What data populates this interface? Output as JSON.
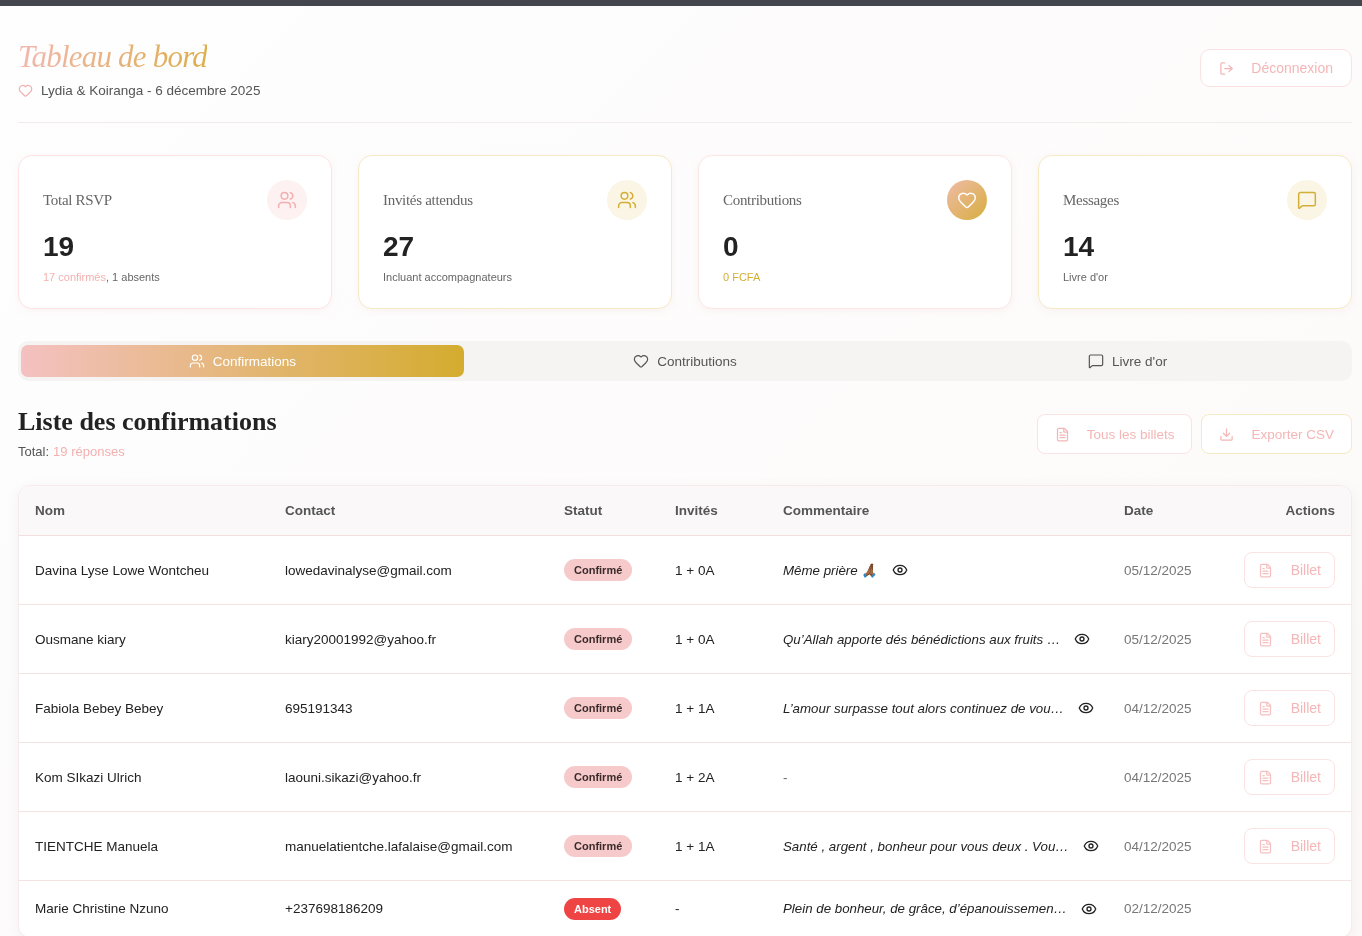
{
  "header": {
    "title": "Tableau de bord",
    "subtitle": "Lydia & Koiranga - 6 décembre 2025",
    "logout_button": "Déconnexion"
  },
  "stats": [
    {
      "label": "Total RSVP",
      "value": "19",
      "kind": "pink",
      "details": [
        {
          "text": "17 confirmés",
          "highlight": true
        },
        {
          "text": ", 1 absents",
          "highlight": false
        }
      ]
    },
    {
      "label": "Invités attendus",
      "value": "27",
      "kind": "gold",
      "details": [
        {
          "text": "Incluant accompagnateurs",
          "highlight": false
        }
      ]
    },
    {
      "label": "Contributions",
      "value": "0",
      "kind": "gradient",
      "details": [
        {
          "text": "0 FCFA",
          "highlight": true
        }
      ]
    },
    {
      "label": "Messages",
      "value": "14",
      "kind": "gold",
      "details": [
        {
          "text": "Livre d'or",
          "highlight": false
        }
      ]
    }
  ],
  "tabs": [
    {
      "label": "Confirmations",
      "selected": true
    },
    {
      "label": "Contributions",
      "selected": false
    },
    {
      "label": "Livre d'or",
      "selected": false
    }
  ],
  "section": {
    "title": "Liste des confirmations",
    "total_label": "Total:",
    "total_value": "19 réponses",
    "buttons": [
      "Tous les billets",
      "Exporter CSV"
    ]
  },
  "table": {
    "columns": [
      "Nom",
      "Contact",
      "Statut",
      "Invités",
      "Commentaire",
      "Date",
      "Actions"
    ],
    "rows": [
      {
        "name": "Davina Lyse Lowe Wontcheu",
        "contact": "lowedavinalyse@gmail.com",
        "status": {
          "label": "Confirmé",
          "kind": "confirmed"
        },
        "guests": "1 + 0A",
        "comment": "Même prière 🙏🏾",
        "viewable": true,
        "date": "05/12/2025",
        "action": "Billet"
      },
      {
        "name": "Ousmane kiary",
        "contact": "kiary20001992@yahoo.fr",
        "status": {
          "label": "Confirmé",
          "kind": "confirmed"
        },
        "guests": "1 + 0A",
        "comment": "Qu’Allah apporte dés bénédictions aux fruits …",
        "viewable": true,
        "date": "05/12/2025",
        "action": "Billet"
      },
      {
        "name": "Fabiola Bebey Bebey",
        "contact": "695191343",
        "status": {
          "label": "Confirmé",
          "kind": "confirmed"
        },
        "guests": "1 + 1A",
        "comment": "L’amour surpasse tout alors continuez de vou…",
        "viewable": true,
        "date": "04/12/2025",
        "action": "Billet"
      },
      {
        "name": "Kom SIkazi Ulrich",
        "contact": "laouni.sikazi@yahoo.fr",
        "status": {
          "label": "Confirmé",
          "kind": "confirmed"
        },
        "guests": "1 + 2A",
        "comment": "-",
        "viewable": false,
        "date": "04/12/2025",
        "action": "Billet"
      },
      {
        "name": "TIENTCHE Manuela",
        "contact": "manuelatientche.lafalaise@gmail.com",
        "status": {
          "label": "Confirmé",
          "kind": "confirmed"
        },
        "guests": "1 + 1A",
        "comment": "Santé , argent , bonheur pour vous deux . Vou…",
        "viewable": true,
        "date": "04/12/2025",
        "action": "Billet"
      },
      {
        "name": "Marie Christine Nzuno",
        "contact": "+237698186209",
        "status": {
          "label": "Absent",
          "kind": "absent"
        },
        "guests": "-",
        "comment": "Plein de bonheur, de grâce, d’épanouissemen…",
        "viewable": true,
        "date": "02/12/2025"
      }
    ]
  }
}
